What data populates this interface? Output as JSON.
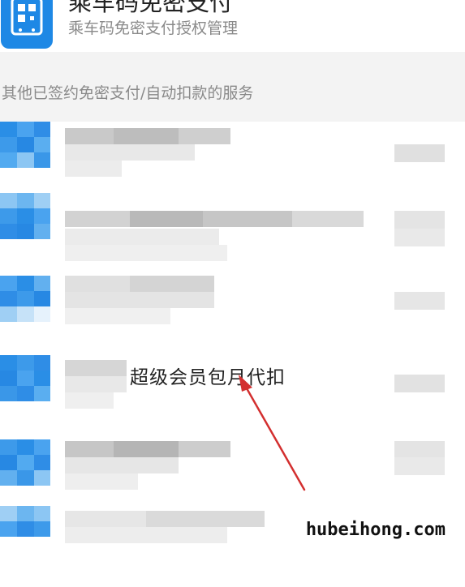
{
  "top_item": {
    "title": "乘车码免密支付",
    "subtitle": "乘车码免密支付授权管理",
    "icon": "bus-qr-icon"
  },
  "section": {
    "header": "其他已签约免密支付/自动扣款的服务"
  },
  "highlighted_service": {
    "label": "超级会员包月代扣"
  },
  "watermark": "hubeihong.com",
  "colors": {
    "accent": "#1e88e5",
    "arrow": "#d32f2f",
    "section_bg": "#f3f3f3"
  }
}
